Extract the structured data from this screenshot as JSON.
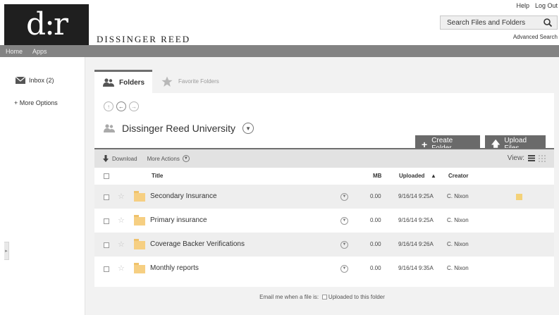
{
  "header": {
    "logo_text": "d:r",
    "brand_name": "DISSINGER REED",
    "top_links": [
      "Help",
      "Log Out"
    ],
    "search_placeholder": "Search Files and Folders",
    "advanced_search": "Advanced Search"
  },
  "nav": {
    "items": [
      "Home",
      "Apps"
    ]
  },
  "sidebar": {
    "inbox_label": "Inbox (2)",
    "more_options": "+ More Options"
  },
  "tabs": {
    "folders": "Folders",
    "favorite": "Favorite Folders"
  },
  "folder": {
    "name": "Dissinger Reed University"
  },
  "buttons": {
    "create_folder": "Create Folder",
    "upload_files": "Upload Files"
  },
  "toolbar": {
    "download": "Download",
    "more_actions": "More Actions",
    "view_label": "View:"
  },
  "table": {
    "headers": {
      "title": "Title",
      "mb": "MB",
      "uploaded": "Uploaded",
      "creator": "Creator"
    },
    "rows": [
      {
        "title": "Secondary Insurance",
        "mb": "0.00",
        "uploaded": "9/16/14 9:25A",
        "creator": "C. Nixon",
        "has_note": true
      },
      {
        "title": "Primary insurance",
        "mb": "0.00",
        "uploaded": "9/16/14 9:25A",
        "creator": "C. Nixon",
        "has_note": false
      },
      {
        "title": "Coverage Backer Verifications",
        "mb": "0.00",
        "uploaded": "9/16/14 9:26A",
        "creator": "C. Nixon",
        "has_note": false
      },
      {
        "title": "Monthly reports",
        "mb": "0.00",
        "uploaded": "9/16/14 9:35A",
        "creator": "C. Nixon",
        "has_note": false
      }
    ]
  },
  "footer": {
    "email_label": "Email me when a file is:",
    "option_label": "Uploaded to this folder"
  },
  "colors": {
    "nav_bg": "#838383",
    "button_bg": "#6a6a6a",
    "folder_icon": "#f6cf82",
    "row_alt": "#eeeeee"
  }
}
